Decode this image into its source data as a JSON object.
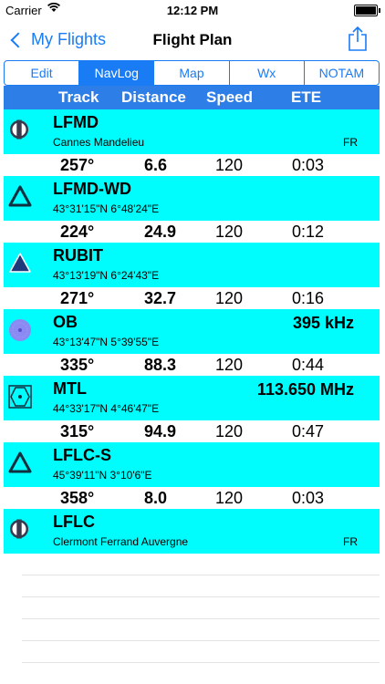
{
  "status": {
    "carrier": "Carrier",
    "time": "12:12 PM"
  },
  "nav": {
    "back_label": "My Flights",
    "title": "Flight Plan"
  },
  "tabs": [
    "Edit",
    "NavLog",
    "Map",
    "Wx",
    "NOTAM"
  ],
  "active_tab": "NavLog",
  "columns": {
    "track": "Track",
    "distance": "Distance",
    "speed": "Speed",
    "ete": "ETE"
  },
  "waypoints": [
    {
      "ident": "LFMD",
      "subtitle": "Cannes Mandelieu",
      "country": "FR",
      "freq": "",
      "icon": "airport-icon"
    },
    {
      "ident": "LFMD-WD",
      "subtitle": "43°31'15\"N  6°48'24\"E",
      "country": "",
      "freq": "",
      "icon": "reporting-point-icon"
    },
    {
      "ident": "RUBIT",
      "subtitle": "43°13'19\"N  6°24'43\"E",
      "country": "",
      "freq": "",
      "icon": "intersection-icon"
    },
    {
      "ident": "OB",
      "subtitle": "43°13'47\"N  5°39'55\"E",
      "country": "",
      "freq": "395 kHz",
      "icon": "ndb-icon"
    },
    {
      "ident": "MTL",
      "subtitle": "44°33'17\"N  4°46'47\"E",
      "country": "",
      "freq": "113.650 MHz",
      "icon": "vor-icon"
    },
    {
      "ident": "LFLC-S",
      "subtitle": "45°39'11\"N  3°10'6\"E",
      "country": "",
      "freq": "",
      "icon": "reporting-point-icon"
    },
    {
      "ident": "LFLC",
      "subtitle": "Clermont Ferrand Auvergne",
      "country": "FR",
      "freq": "",
      "icon": "airport-icon"
    }
  ],
  "legs": [
    {
      "track": "257°",
      "distance": "6.6",
      "speed": "120",
      "ete": "0:03"
    },
    {
      "track": "224°",
      "distance": "24.9",
      "speed": "120",
      "ete": "0:12"
    },
    {
      "track": "271°",
      "distance": "32.7",
      "speed": "120",
      "ete": "0:16"
    },
    {
      "track": "335°",
      "distance": "88.3",
      "speed": "120",
      "ete": "0:44"
    },
    {
      "track": "315°",
      "distance": "94.9",
      "speed": "120",
      "ete": "0:47"
    },
    {
      "track": "358°",
      "distance": "8.0",
      "speed": "120",
      "ete": "0:03"
    }
  ],
  "colors": {
    "accent": "#1a7cf5",
    "header": "#2e7ee8",
    "waypoint_bg": "#00fdfd"
  }
}
